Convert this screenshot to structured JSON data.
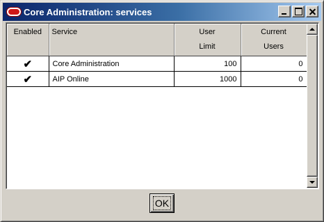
{
  "window": {
    "title": "Core Administration: services",
    "app_icon": "oracle-icon",
    "controls": [
      "minimize-icon",
      "maximize-icon",
      "close-icon"
    ]
  },
  "table": {
    "columns": [
      {
        "line1": "",
        "line2": "Enabled"
      },
      {
        "line1": "",
        "line2": "Service"
      },
      {
        "line1": "User",
        "line2": "Limit"
      },
      {
        "line1": "Current",
        "line2": "Users"
      }
    ],
    "rows": [
      {
        "enabled": "✔",
        "service": "Core Administration",
        "user_limit": "100",
        "current_users": "0"
      },
      {
        "enabled": "✔",
        "service": "AIP Online",
        "user_limit": "1000",
        "current_users": "0"
      }
    ]
  },
  "buttons": {
    "ok_label": "OK"
  },
  "colors": {
    "titlebar_start": "#0a246a",
    "titlebar_end": "#a6caf0",
    "face": "#d4d0c8"
  }
}
